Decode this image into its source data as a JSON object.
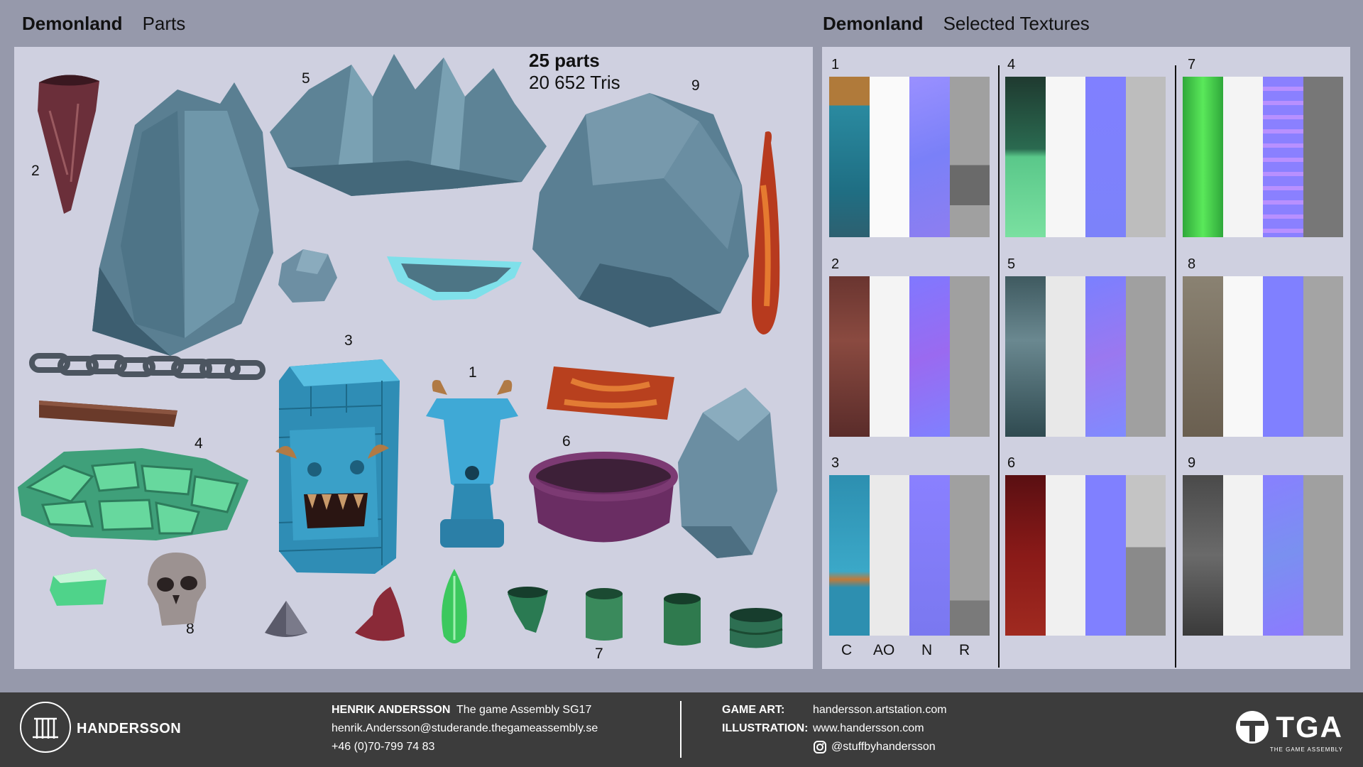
{
  "header_left": {
    "title": "Demonland",
    "subtitle": "Parts"
  },
  "header_right": {
    "title": "Demonland",
    "subtitle": "Selected Textures"
  },
  "summary": {
    "parts": "25 parts",
    "tris": "20 652 Tris"
  },
  "part_numbers": [
    "1",
    "2",
    "3",
    "4",
    "5",
    "6",
    "7",
    "8",
    "9"
  ],
  "texture_sets": [
    "1",
    "2",
    "3",
    "4",
    "5",
    "6",
    "7",
    "8",
    "9"
  ],
  "channels": [
    "C",
    "AO",
    "N",
    "R"
  ],
  "footer": {
    "brand": "HANDERSSON",
    "name": "HENRIK ANDERSSON",
    "school": "The game Assembly SG17",
    "email": "henrik.Andersson@studerande.thegameassembly.se",
    "phone": "+46 (0)70-799 74 83",
    "game_art_label": "GAME ART:",
    "game_art_url": "handersson.artstation.com",
    "illustration_label": "ILLUSTRATION:",
    "illustration_url": "www.handersson.com",
    "instagram": "@stuffbyhandersson",
    "tga_logo": "TGA",
    "tga_sub": "THE GAME ASSEMBLY"
  },
  "colors": {
    "background": "#9699ab",
    "panel": "#cfd0e0",
    "rock": "#5f8496",
    "footer": "#3c3c3c",
    "normal": "#8080ff"
  }
}
